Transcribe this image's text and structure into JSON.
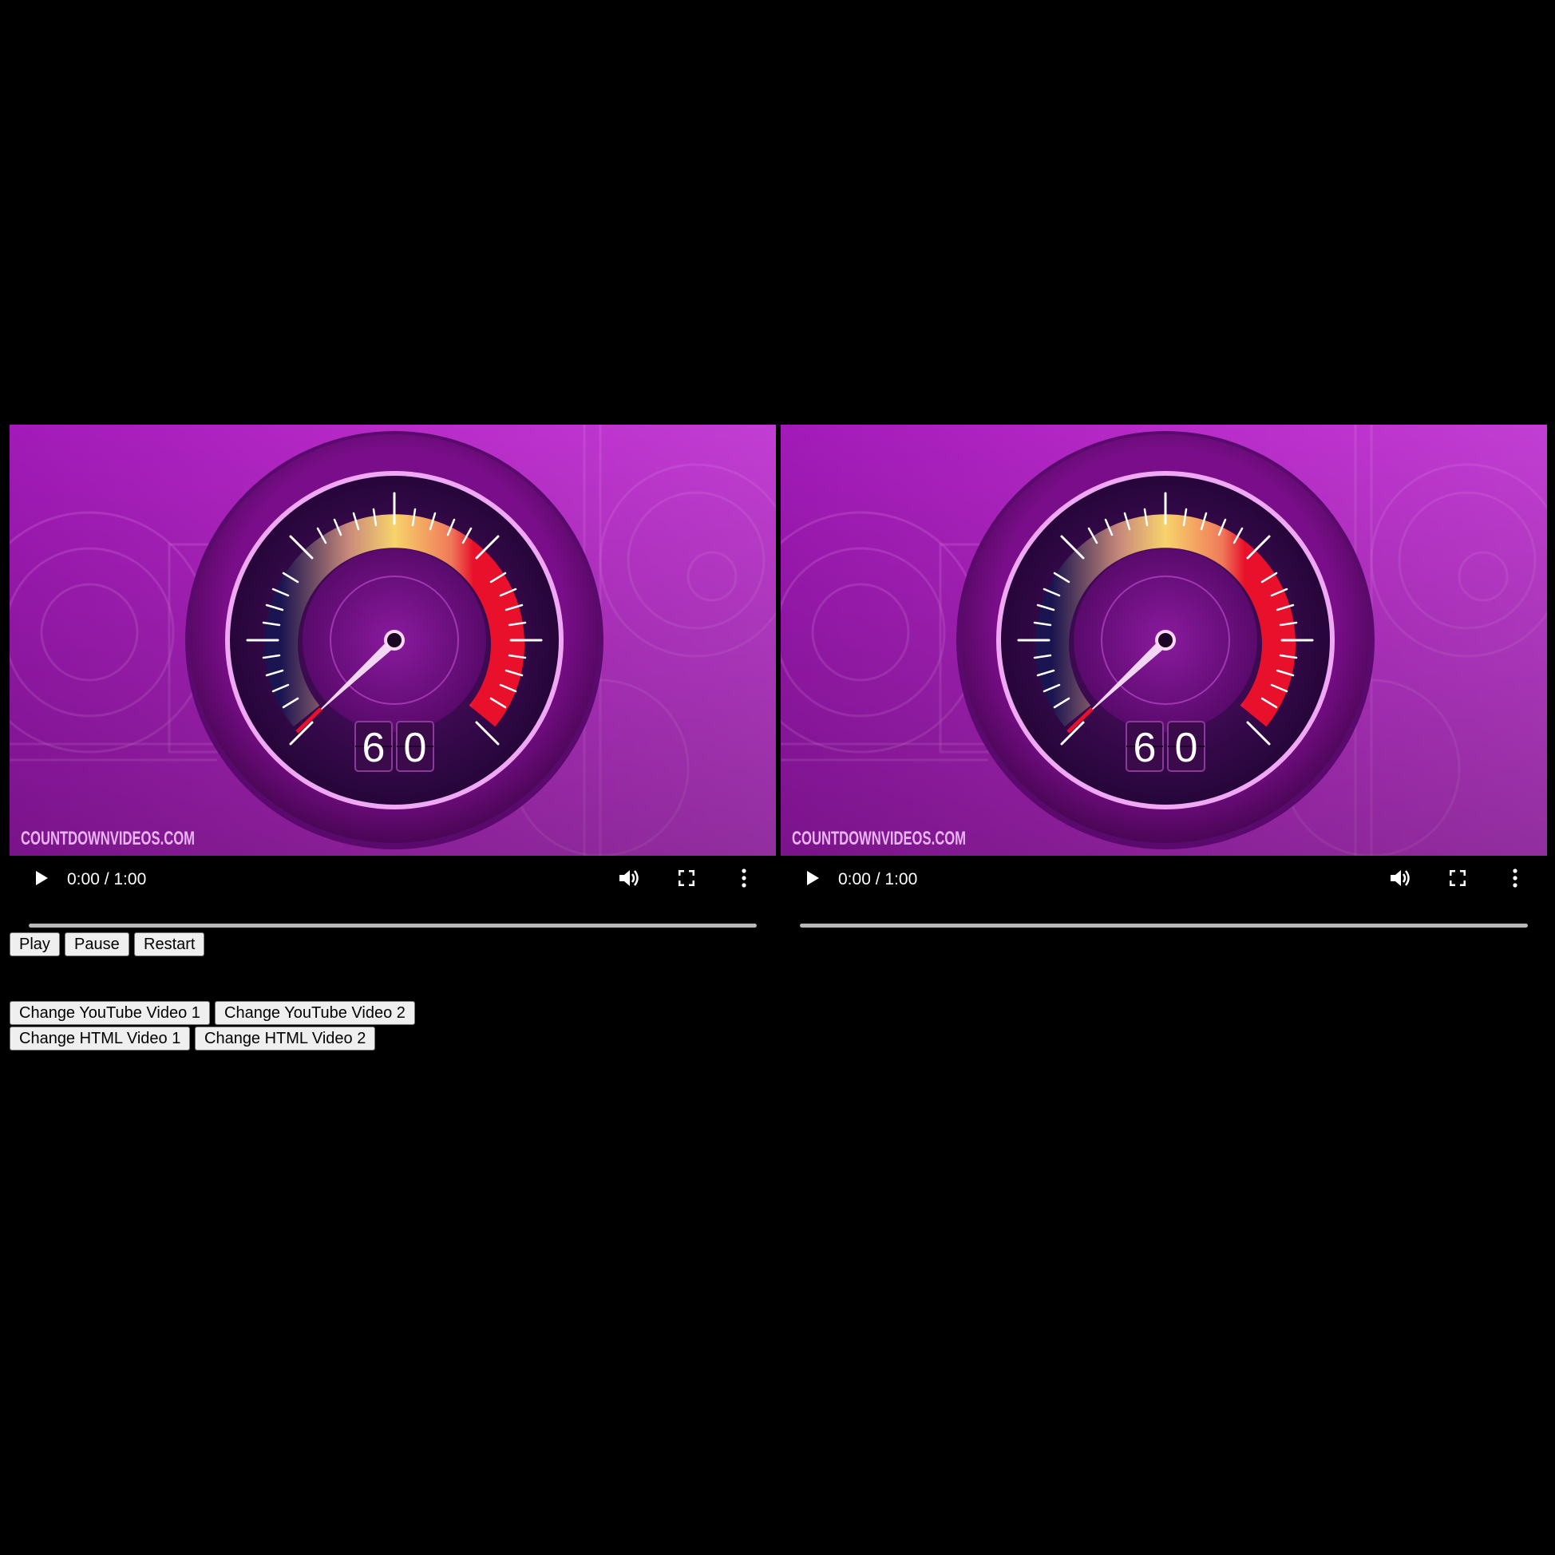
{
  "players": [
    {
      "watermark": "COUNTDOWNVIDEOS.COM",
      "counter_digits": [
        "6",
        "0"
      ],
      "time_display": "0:00 / 1:00",
      "progress_fraction": 0.0,
      "icons": [
        "play-icon",
        "volume-icon",
        "fullscreen-icon",
        "more-options-icon"
      ]
    },
    {
      "watermark": "COUNTDOWNVIDEOS.COM",
      "counter_digits": [
        "6",
        "0"
      ],
      "time_display": "0:00 / 1:00",
      "progress_fraction": 0.0,
      "icons": [
        "play-icon",
        "volume-icon",
        "fullscreen-icon",
        "more-options-icon"
      ]
    }
  ],
  "playback_buttons": {
    "play": "Play",
    "pause": "Pause",
    "restart": "Restart"
  },
  "change_buttons": {
    "youtube_1": "Change YouTube Video 1",
    "youtube_2": "Change YouTube Video 2",
    "html_1": "Change HTML Video 1",
    "html_2": "Change HTML Video 2"
  },
  "colors": {
    "background": "#000000",
    "video_purple": "#b01fc2",
    "gauge_red": "#e8102a",
    "gauge_gold": "#f7d36b",
    "gauge_navy": "#1a1450"
  }
}
